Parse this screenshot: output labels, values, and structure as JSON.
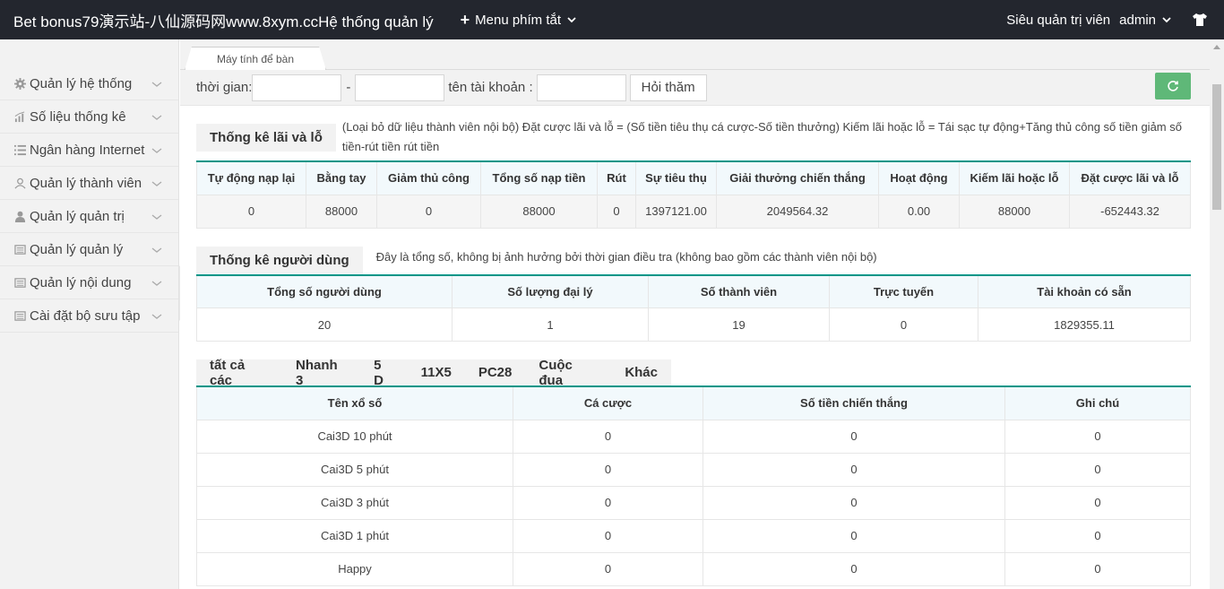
{
  "header": {
    "brand": "Bet bonus79演示站-八仙源码网www.8xym.ccHệ thống quản lý",
    "quick_menu": "Menu phím tắt",
    "role": "Siêu quản trị viên",
    "user": "admin"
  },
  "sidebar": {
    "items": [
      {
        "label": "Quản lý hệ thống",
        "icon": "gear-icon"
      },
      {
        "label": "Số liệu thống kê",
        "icon": "bar-chart-icon"
      },
      {
        "label": "Ngân hàng Internet",
        "icon": "list-icon"
      },
      {
        "label": "Quản lý thành viên",
        "icon": "user-outline-icon"
      },
      {
        "label": "Quản lý quản trị",
        "icon": "user-icon"
      },
      {
        "label": "Quản lý quản lý",
        "icon": "book-icon"
      },
      {
        "label": "Quản lý nội dung",
        "icon": "book-icon"
      },
      {
        "label": "Cài đặt bộ sưu tập",
        "icon": "book-icon"
      }
    ]
  },
  "tab": {
    "label": "Máy tính để bàn"
  },
  "toolbar": {
    "time_label": "thời gian:",
    "dash": "-",
    "account_label": "tên tài khoản :",
    "query_button": "Hỏi thăm"
  },
  "profit": {
    "title": "Thống kê lãi và lỗ",
    "note": "(Loại bỏ dữ liệu thành viên nội bộ)  Đặt cược lãi và lỗ = (Số tiền tiêu thụ cá cược-Số tiền thưởng)    Kiếm lãi hoặc lỗ = Tái sạc tự động+Tăng thủ công số tiền giảm số tiền-rút tiền rút tiền",
    "headers": [
      "Tự động nạp lại",
      "Bằng tay",
      "Giảm thủ công",
      "Tổng số nạp tiền",
      "Rút",
      "Sự tiêu thụ",
      "Giải thưởng chiến thắng",
      "Hoạt động",
      "Kiếm lãi hoặc lỗ",
      "Đặt cược lãi và lỗ"
    ],
    "row": [
      "0",
      "88000",
      "0",
      "88000",
      "0",
      "1397121.00",
      "2049564.32",
      "0.00",
      "88000",
      "-652443.32"
    ]
  },
  "users": {
    "title": "Thống kê người dùng",
    "note": "Đây là tổng số, không bị ảnh hưởng bởi thời gian điều tra (không bao gồm các thành viên nội bộ)",
    "headers": [
      "Tổng số người dùng",
      "Số lượng đại lý",
      "Số thành viên",
      "Trực tuyến",
      "Tài khoản có sẵn"
    ],
    "row": [
      "20",
      "1",
      "19",
      "0",
      "1829355.11"
    ]
  },
  "lottery": {
    "tabs": [
      "tất cả các",
      "Nhanh 3",
      "5 D",
      "11X5",
      "PC28",
      "Cuộc đua",
      "Khác"
    ],
    "headers": [
      "Tên xổ số",
      "Cá cược",
      "Số tiền chiến thắng",
      "Ghi chú"
    ],
    "rows": [
      [
        "Cai3D 10 phút",
        "0",
        "0",
        "0"
      ],
      [
        "Cai3D 5 phút",
        "0",
        "0",
        "0"
      ],
      [
        "Cai3D 3 phút",
        "0",
        "0",
        "0"
      ],
      [
        "Cai3D 1 phút",
        "0",
        "0",
        "0"
      ],
      [
        "Happy",
        "0",
        "0",
        "0"
      ]
    ]
  },
  "colors": {
    "topbar": "#23262e",
    "accent": "#009688",
    "refresh": "#5fb878"
  }
}
